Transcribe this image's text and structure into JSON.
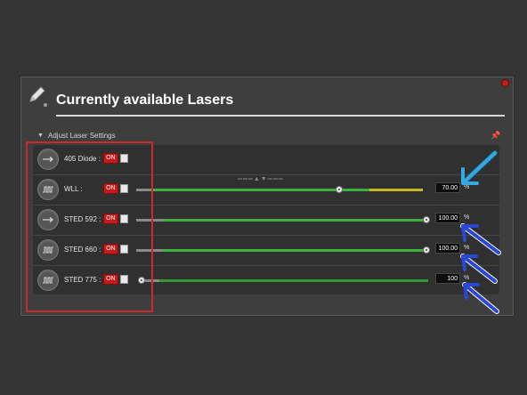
{
  "panel": {
    "title": "Currently available Lasers",
    "section_label": "Adjust Laser Settings",
    "icons": {
      "title": "pencil-icon",
      "close": "close-icon",
      "pin": "pin-icon",
      "section": "collapse-triangle-icon"
    }
  },
  "lasers": [
    {
      "name": "405 Diode :",
      "state": "ON",
      "icon": "arrow-right-icon",
      "value": "",
      "unit": ""
    },
    {
      "name": "WLL :",
      "state": "ON",
      "icon": "pulse-icon",
      "value": "70.00",
      "unit": "%"
    },
    {
      "name": "STED 592 :",
      "state": "ON",
      "icon": "arrow-right-icon",
      "value": "100.00",
      "unit": "%"
    },
    {
      "name": "STED 660 :",
      "state": "ON",
      "icon": "pulse-icon",
      "value": "100.00",
      "unit": "%"
    },
    {
      "name": "STED 775 :",
      "state": "ON",
      "icon": "pulse-icon",
      "value": "100",
      "unit": "%"
    }
  ],
  "colors": {
    "on": "#c61a1a",
    "green": "#3fb13f",
    "yellow": "#c8b623",
    "annotation_red": "#cc2a2a",
    "annotation_cyan": "#35a9e0",
    "annotation_blue": "#2a47d6"
  }
}
